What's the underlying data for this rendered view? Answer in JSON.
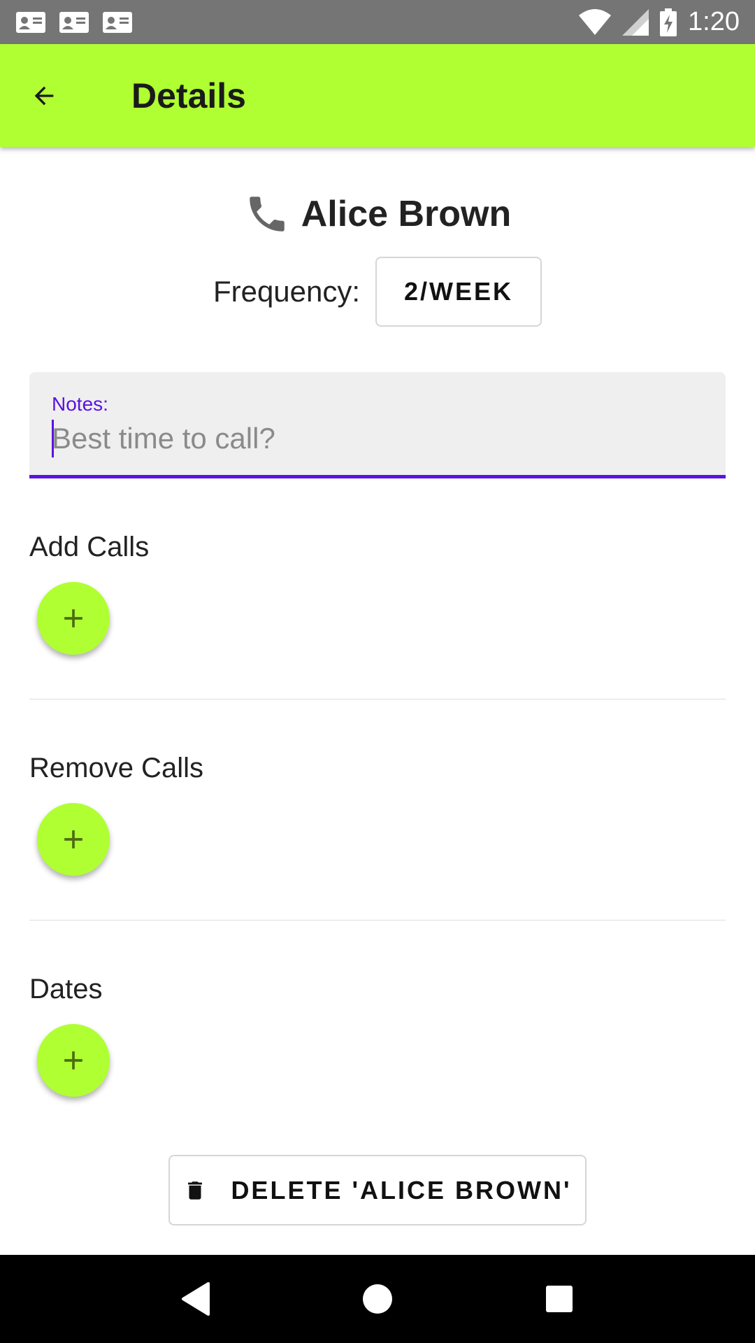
{
  "status_bar": {
    "time": "1:20",
    "notification_icons": [
      "contact-card-icon",
      "contact-card-icon",
      "contact-card-icon"
    ],
    "system_icons": [
      "wifi-icon",
      "signal-icon",
      "battery-charging-icon"
    ]
  },
  "app_bar": {
    "title": "Details",
    "back_icon": "arrow-back-icon",
    "background": "#b0ff33"
  },
  "contact": {
    "icon": "phone-icon",
    "name": "Alice Brown"
  },
  "frequency": {
    "label": "Frequency:",
    "value": "2/WEEK"
  },
  "notes": {
    "label": "Notes:",
    "placeholder": "Best time to call?",
    "accent": "#5b13e0"
  },
  "sections": [
    {
      "label": "Add Calls",
      "button_icon": "plus-icon"
    },
    {
      "label": "Remove Calls",
      "button_icon": "plus-icon"
    },
    {
      "label": "Dates",
      "button_icon": "plus-icon"
    }
  ],
  "delete_button": {
    "icon": "trash-icon",
    "label": "DELETE 'ALICE BROWN'"
  },
  "nav_bar": {
    "buttons": [
      "back-triangle-icon",
      "home-circle-icon",
      "recents-square-icon"
    ]
  }
}
